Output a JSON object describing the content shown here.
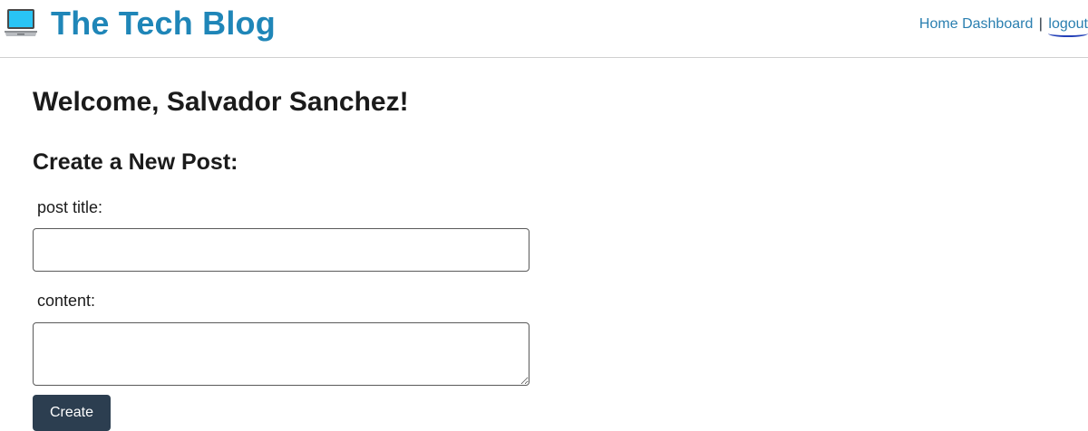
{
  "header": {
    "brand_icon": "laptop-icon",
    "title": "The Tech Blog",
    "nav": {
      "home_label": "Home",
      "dashboard_label": "Dashboard",
      "separator": "|",
      "logout_label": "logout"
    }
  },
  "main": {
    "welcome": "Welcome, Salvador Sanchez!",
    "form_heading": "Create a New Post:",
    "title_label": "post title:",
    "title_value": "",
    "content_label": "content:",
    "content_value": "",
    "submit_label": "Create"
  },
  "colors": {
    "brand": "#1f86b8",
    "link": "#2a7fb0",
    "button_bg": "#2c3e50"
  }
}
